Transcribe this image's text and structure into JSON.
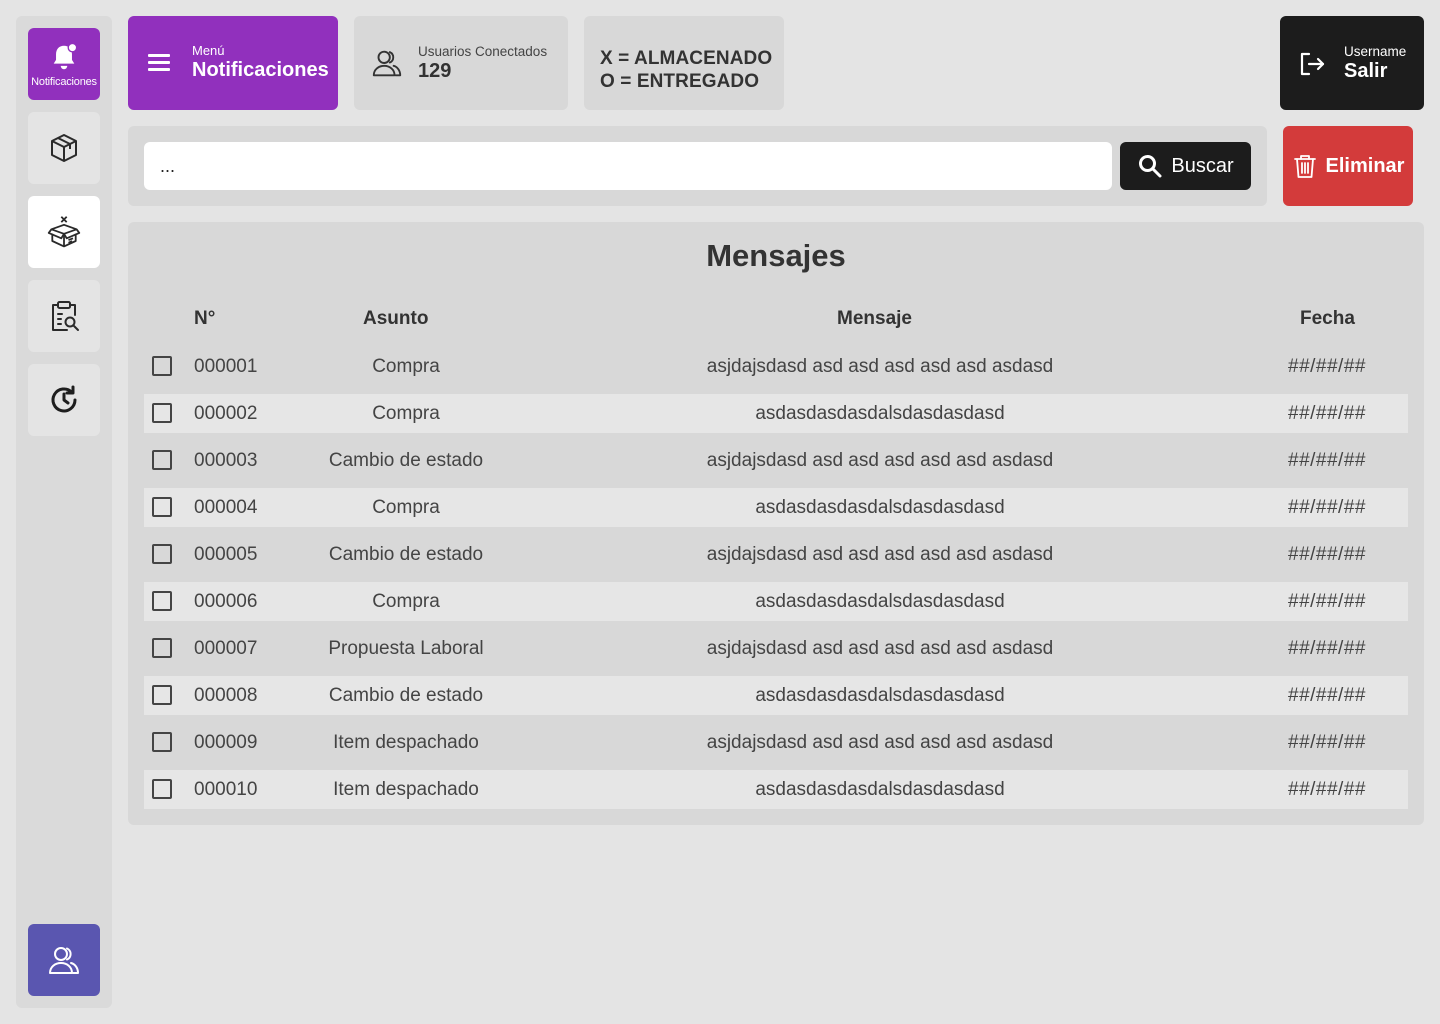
{
  "sidebar": {
    "notifications_label": "Notificaciones",
    "items": [
      {
        "icon": "bell-icon",
        "label": "Notificaciones"
      },
      {
        "icon": "package-icon"
      },
      {
        "icon": "open-box-icon"
      },
      {
        "icon": "clipboard-search-icon"
      },
      {
        "icon": "history-icon"
      },
      {
        "icon": "users-icon"
      }
    ]
  },
  "header": {
    "menu_small": "Menú",
    "menu_title": "Notificaciones",
    "users_label": "Usuarios Conectados",
    "users_count": "129",
    "legend_line1": "X = ALMACENADO",
    "legend_line2": "O = ENTREGADO",
    "username": "Username",
    "logout_label": "Salir"
  },
  "search": {
    "value": "...",
    "button_label": "Buscar",
    "delete_label": "Eliminar"
  },
  "messages": {
    "title": "Mensajes",
    "columns": [
      "N°",
      "Asunto",
      "Mensaje",
      "Fecha"
    ],
    "rows": [
      {
        "num": "000001",
        "subject": "Compra",
        "message": "asjdajsdasd asd asd asd asd asd asdasd",
        "date": "##/##/##"
      },
      {
        "num": "000002",
        "subject": "Compra",
        "message": "asdasdasdasdalsdasdasdasd",
        "date": "##/##/##"
      },
      {
        "num": "000003",
        "subject": "Cambio de estado",
        "message": "asjdajsdasd asd asd asd asd asd asdasd",
        "date": "##/##/##"
      },
      {
        "num": "000004",
        "subject": "Compra",
        "message": "asdasdasdasdalsdasdasdasd",
        "date": "##/##/##"
      },
      {
        "num": "000005",
        "subject": "Cambio de estado",
        "message": "asjdajsdasd asd asd asd asd asd asdasd",
        "date": "##/##/##"
      },
      {
        "num": "000006",
        "subject": "Compra",
        "message": "asdasdasdasdalsdasdasdasd",
        "date": "##/##/##"
      },
      {
        "num": "000007",
        "subject": "Propuesta Laboral",
        "message": "asjdajsdasd asd asd asd asd asd asdasd",
        "date": "##/##/##"
      },
      {
        "num": "000008",
        "subject": "Cambio de estado",
        "message": "asdasdasdasdalsdasdasdasd",
        "date": "##/##/##"
      },
      {
        "num": "000009",
        "subject": "Item despachado",
        "message": "asjdajsdasd asd asd asd asd asd asdasd",
        "date": "##/##/##"
      },
      {
        "num": "000010",
        "subject": "Item despachado",
        "message": "asdasdasdasdalsdasdasdasd",
        "date": "##/##/##"
      }
    ]
  },
  "colors": {
    "accent_purple": "#9130bd",
    "users_blue": "#5a56b0",
    "danger_red": "#d33b3b",
    "dark": "#1c1c1c"
  }
}
